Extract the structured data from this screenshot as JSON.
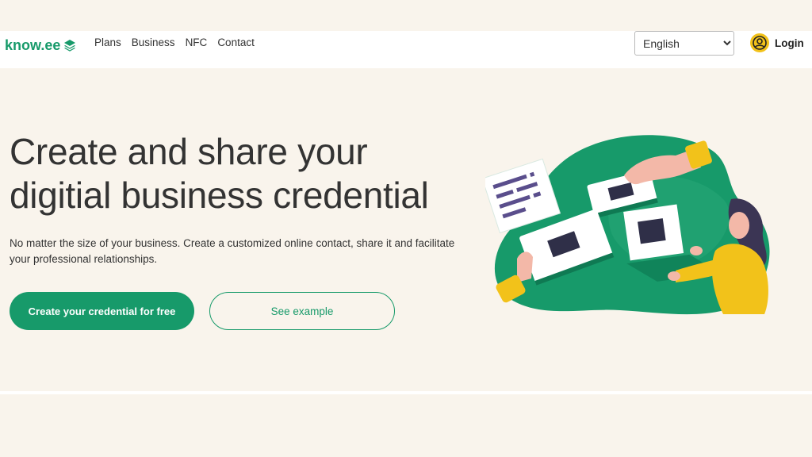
{
  "brand": {
    "name": "know.ee",
    "accent": "#179a6a"
  },
  "nav": {
    "links": [
      "Plans",
      "Business",
      "NFC",
      "Contact"
    ],
    "language": {
      "selected": "English"
    },
    "login_label": "Login"
  },
  "hero": {
    "title_line1": "Create and share your",
    "title_line2": "digitial business credential",
    "description": "No matter the size of your business. Create a customized online contact, share it and facilitate your professional relationships.",
    "primary_cta": "Create your credential for free",
    "secondary_cta": "See example"
  },
  "icons": {
    "logo": "layers-icon",
    "login": "user-circle-icon",
    "select": "chevron-down-icon"
  },
  "colors": {
    "background": "#f9f4ec",
    "green": "#179a6a",
    "yellow": "#f2c21a"
  }
}
